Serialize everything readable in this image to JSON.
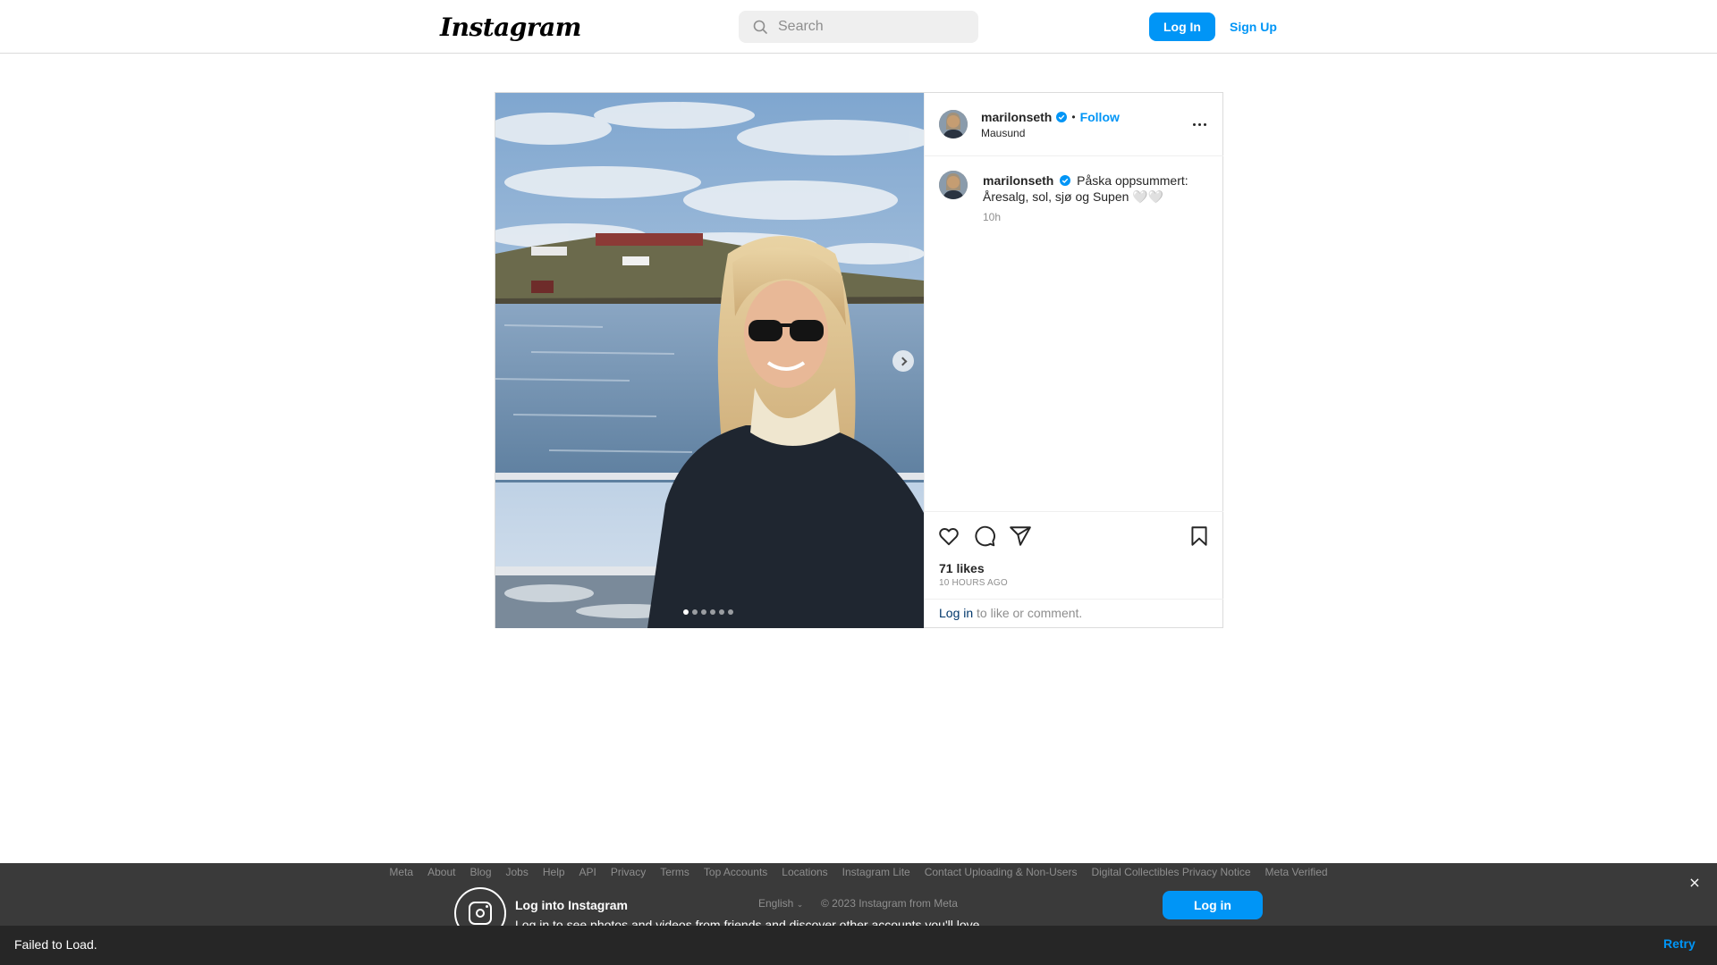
{
  "header": {
    "logo": "Instagram",
    "search_placeholder": "Search",
    "login_label": "Log In",
    "signup_label": "Sign Up"
  },
  "post": {
    "username": "marilonseth",
    "follow_label": "Follow",
    "bullet": "•",
    "location": "Mausund",
    "caption_text": "Påska oppsummert: Åresalg, sol, sjø og Supen 🤍🤍",
    "caption_time": "10h",
    "likes": "71 likes",
    "time_ago": "10 HOURS AGO",
    "login_link": "Log in",
    "login_suffix": " to like or comment.",
    "carousel": {
      "total": 6,
      "active_index": 0
    }
  },
  "overlay": {
    "links": [
      "Meta",
      "About",
      "Blog",
      "Jobs",
      "Help",
      "API",
      "Privacy",
      "Terms",
      "Top Accounts",
      "Locations",
      "Instagram Lite",
      "Contact Uploading & Non-Users",
      "Digital Collectibles Privacy Notice",
      "Meta Verified"
    ],
    "title": "Log into Instagram",
    "subtitle": "Log in to see photos and videos from friends and discover other accounts you'll love.",
    "language": "English",
    "copyright": "© 2023 Instagram from Meta",
    "login_label": "Log in",
    "close_label": "×"
  },
  "error_bar": {
    "message": "Failed to Load.",
    "retry_label": "Retry"
  },
  "colors": {
    "accent": "#0095f6",
    "overlay_bg": "#3a3a3a",
    "error_bg": "#262626"
  }
}
